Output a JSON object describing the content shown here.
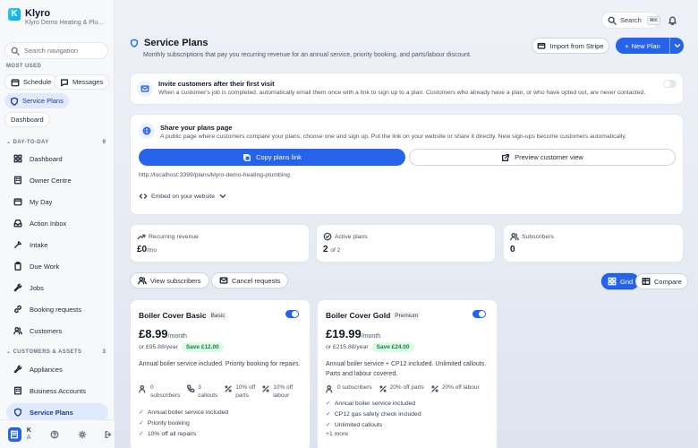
{
  "brand": {
    "name": "Klyro",
    "company": "Klyro Demo Heating & Plumbing",
    "logo_letter": "K"
  },
  "sidebar": {
    "search_placeholder": "Search navigation",
    "most_used_label": "Most used",
    "most_used": [
      {
        "label": "Schedule",
        "icon": "calendar-icon"
      },
      {
        "label": "Messages",
        "icon": "message-icon"
      },
      {
        "label": "Service Plans",
        "icon": "shield-icon",
        "active": true
      }
    ],
    "dashboard_label": "Dashboard",
    "day_to_day_label": "Day-to-day",
    "day_to_day_count": "9",
    "day_to_day": [
      {
        "label": "Dashboard",
        "icon": "grid-icon"
      },
      {
        "label": "Owner Centre",
        "icon": "building-icon"
      },
      {
        "label": "My Day",
        "icon": "calendar-icon"
      },
      {
        "label": "Action Inbox",
        "icon": "inbox-icon"
      },
      {
        "label": "Intake",
        "icon": "intake-icon"
      },
      {
        "label": "Due Work",
        "icon": "clipboard-icon"
      },
      {
        "label": "Jobs",
        "icon": "wrench-icon"
      },
      {
        "label": "Booking requests",
        "icon": "link-icon"
      },
      {
        "label": "Customers",
        "icon": "users-icon"
      }
    ],
    "customers_assets_label": "Customers & assets",
    "customers_assets_count": "3",
    "customers_assets": [
      {
        "label": "Appliances",
        "icon": "wrench-icon"
      },
      {
        "label": "Business Accounts",
        "icon": "building-icon"
      },
      {
        "label": "Service Plans",
        "icon": "shield-icon",
        "active": true
      }
    ],
    "footer": {
      "avatar_text": "K",
      "user_line1": "K",
      "user_line2": "A"
    }
  },
  "topbar": {
    "search_label": "Search",
    "search_shortcut": "⌘K"
  },
  "page": {
    "title": "Service Plans",
    "subtitle": "Monthly subscriptions that pay you recurring revenue for an annual service, priority booking, and parts/labour discount.",
    "import_label": "Import from Stripe",
    "new_plan_label": "New Plan"
  },
  "invite": {
    "title": "Invite customers after their first visit",
    "text": "When a customer's job is completed, automatically email them once with a link to sign up to a plan. Customers who already have a plan, or who have opted out, are never contacted.",
    "enabled": false
  },
  "share": {
    "title": "Share your plans page",
    "text": "A public page where customers compare your plans, choose one and sign up. Put the link on your website or share it directly. New sign-ups become customers automatically.",
    "copy_label": "Copy plans link",
    "preview_label": "Preview customer view",
    "url": "http://localhost:3399/plans/klyro-demo-heating-plumbing",
    "embed_label": "Embed on your website"
  },
  "stats": [
    {
      "label": "Recurring revenue",
      "value": "£0",
      "suffix": "/mo",
      "icon": "trend-icon"
    },
    {
      "label": "Active plans",
      "value": "2",
      "suffix": "of 2",
      "icon": "check-circle-icon"
    },
    {
      "label": "Subscribers",
      "value": "0",
      "suffix": "",
      "icon": "users-icon"
    }
  ],
  "actions": {
    "view_subscribers": "View subscribers",
    "cancel_requests": "Cancel requests",
    "grid": "Grid",
    "compare": "Compare"
  },
  "plans": [
    {
      "name": "Boiler Cover Basic",
      "tier": "Basic",
      "price": "£8.99",
      "period": "/month",
      "yearly": "or £95.88/year",
      "save": "Save £12.00",
      "description": "Annual boiler service included. Priority booking for repairs.",
      "enabled": true,
      "stats": [
        {
          "a": "0",
          "b": "subscribers",
          "icon": "users-icon"
        },
        {
          "a": "3",
          "b": "callouts",
          "icon": "phone-icon"
        },
        {
          "a": "10% off",
          "b": "parts",
          "icon": "percent-icon"
        },
        {
          "a": "10% off",
          "b": "labour",
          "icon": "percent-icon"
        }
      ],
      "features": [
        "Annual boiler service included",
        "Priority booking",
        "10% off all repairs"
      ],
      "more": ""
    },
    {
      "name": "Boiler Cover Gold",
      "tier": "Premium",
      "price": "£19.99",
      "period": "/month",
      "yearly": "or £215.88/year",
      "save": "Save £24.00",
      "description": "Annual boiler service + CP12 included. Unlimited callouts. Parts and labour covered.",
      "enabled": true,
      "stats": [
        {
          "a": "0 subscribers",
          "b": "",
          "icon": "users-icon"
        },
        {
          "a": "20% off parts",
          "b": "",
          "icon": "percent-icon"
        },
        {
          "a": "20% off labour",
          "b": "",
          "icon": "percent-icon"
        }
      ],
      "features": [
        "Annual boiler service included",
        "CP12 gas safety check included",
        "Unlimited callouts"
      ],
      "more": "+1 more"
    }
  ]
}
